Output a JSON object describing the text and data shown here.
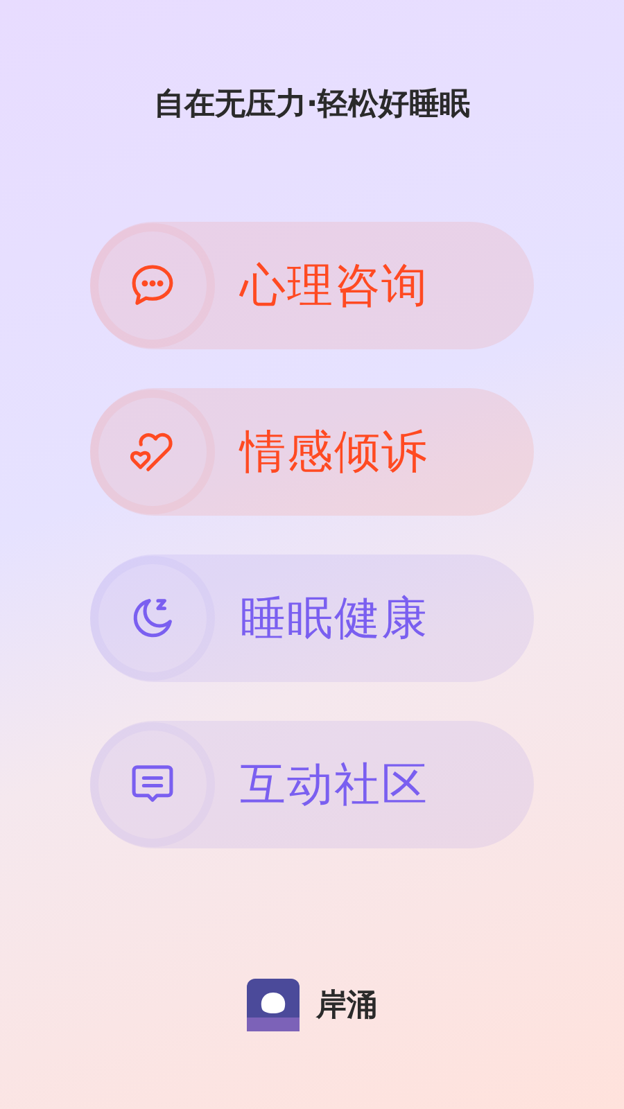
{
  "tagline": "自在无压力·轻松好睡眠",
  "menu": [
    {
      "kind": "chat",
      "label": "心理咨询",
      "color": "#ff4a22"
    },
    {
      "kind": "heart",
      "label": "情感倾诉",
      "color": "#ff4a22"
    },
    {
      "kind": "moon",
      "label": "睡眠健康",
      "color": "#7a5ff0"
    },
    {
      "kind": "message",
      "label": "互动社区",
      "color": "#7a5ff0"
    }
  ],
  "brand": {
    "name": "岸涌"
  }
}
